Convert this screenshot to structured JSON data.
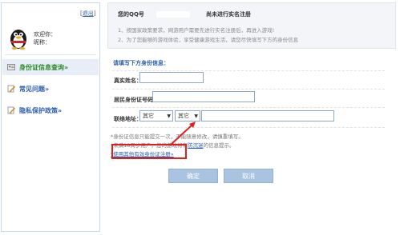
{
  "sidebar": {
    "logout_open": "[",
    "logout_label": "退出",
    "logout_close": "]",
    "welcome_label": "欢迎你：",
    "nickname_label": "昵称：",
    "items": [
      {
        "label": "身份证信息查询»",
        "icon": "id-card-icon"
      },
      {
        "label": "常见问题»",
        "icon": "pencil-icon"
      },
      {
        "label": "隐私保护政策»",
        "icon": "pencil-icon"
      }
    ]
  },
  "notice": {
    "title_prefix": "您的QQ号",
    "title_suffix": "尚未进行实名注册",
    "line1": "1、按国家政策要求，网游用户需要先进行实名注册后，再进入游戏!",
    "line2": "2、为了您能够的游戏体验，享受健康游戏生活，请您尽快填写下方的身份信息"
  },
  "form": {
    "title": "请填写下方身份信息：",
    "name_label": "真实姓名：",
    "name_value": "",
    "id_label": "居民身份证号码：",
    "id_value": "",
    "address_label": "联络地址：",
    "province_value": "其它",
    "city_value": "其它",
    "address_value": ""
  },
  "tips": {
    "line1": "*身份证信息只能提交一次，不能随意修改，请慎重填写。",
    "line2_a": "*未满18周岁用户，您的游戏将有",
    "line2_link": "防沉迷",
    "line2_b": "的信息提示。",
    "line3_link": "*使用其他有效身份证注册»"
  },
  "buttons": {
    "confirm": "确定",
    "cancel": "取消"
  },
  "colors": {
    "accent_blue": "#2a5db0",
    "active_green": "#2d8a2a",
    "annotation_red": "#e02020",
    "button_bg": "#a9c4e0"
  }
}
